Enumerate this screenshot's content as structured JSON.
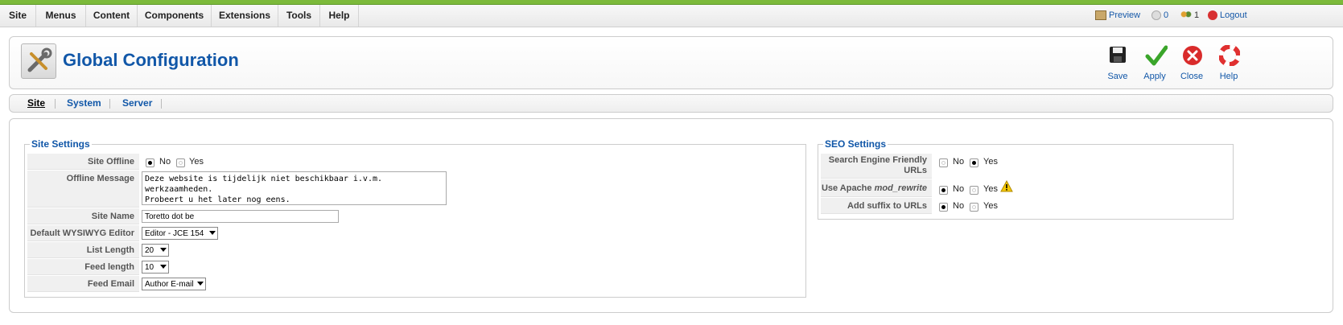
{
  "menu": [
    "Site",
    "Menus",
    "Content",
    "Components",
    "Extensions",
    "Tools",
    "Help"
  ],
  "status": {
    "preview": "Preview",
    "messages": "0",
    "users": "1",
    "logout": "Logout"
  },
  "header": {
    "title": "Global Configuration"
  },
  "toolbar": {
    "save": "Save",
    "apply": "Apply",
    "close": "Close",
    "help": "Help"
  },
  "tabs": [
    "Site",
    "System",
    "Server"
  ],
  "site_settings": {
    "legend": "Site Settings",
    "offline_label": "Site Offline",
    "offline_no": "No",
    "offline_yes": "Yes",
    "offline_value": "No",
    "message_label": "Offline Message",
    "message_value": "Deze website is tijdelijk niet beschikbaar i.v.m. werkzaamheden.\nProbeert u het later nog eens.",
    "sitename_label": "Site Name",
    "sitename_value": "Toretto dot be",
    "editor_label": "Default WYSIWYG Editor",
    "editor_value": "Editor - JCE 154",
    "listlength_label": "List Length",
    "listlength_value": "20",
    "feedlength_label": "Feed length",
    "feedlength_value": "10",
    "feedemail_label": "Feed Email",
    "feedemail_value": "Author E-mail"
  },
  "seo_settings": {
    "legend": "SEO Settings",
    "sef_label": "Search Engine Friendly URLs",
    "sef_value": "Yes",
    "rewrite_label_prefix": "Use Apache",
    "rewrite_label_em": "mod_rewrite",
    "rewrite_value": "No",
    "suffix_label": "Add suffix to URLs",
    "suffix_value": "No",
    "no": "No",
    "yes": "Yes"
  },
  "colors": {
    "brand_green": "#7cba3b",
    "link_blue": "#1157a8"
  }
}
